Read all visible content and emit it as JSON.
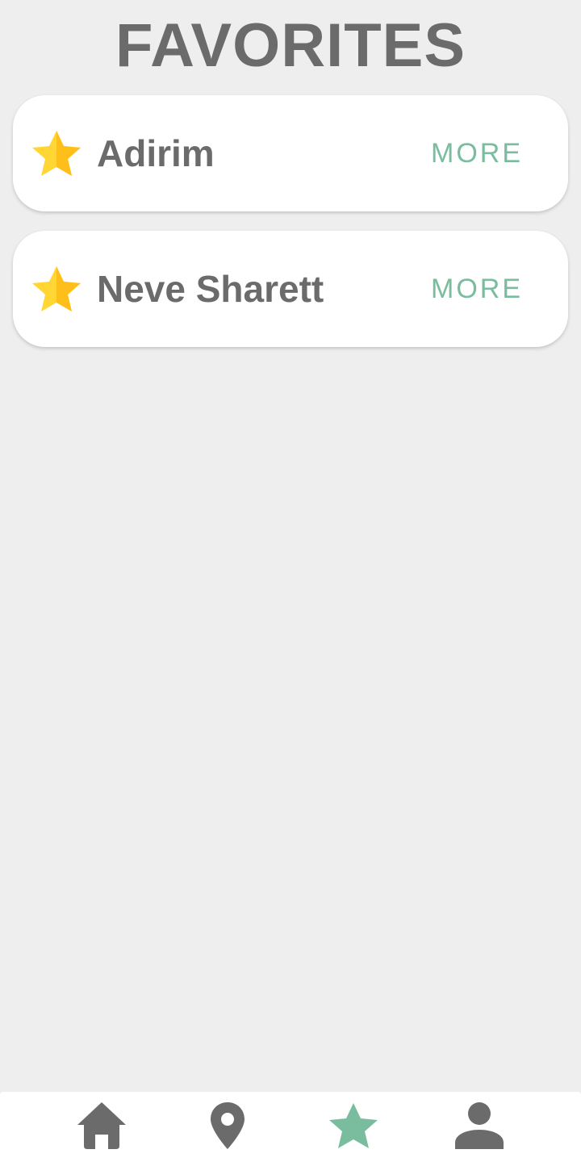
{
  "header": {
    "title": "FAVORITES"
  },
  "favorites": [
    {
      "name": "Adirim",
      "more_label": "MORE",
      "icon": "star-icon"
    },
    {
      "name": "Neve Sharett",
      "more_label": "MORE",
      "icon": "star-icon"
    }
  ],
  "bottom_nav": {
    "items": [
      {
        "icon": "home-icon",
        "active": false
      },
      {
        "icon": "location-pin-icon",
        "active": false
      },
      {
        "icon": "star-icon",
        "active": true
      },
      {
        "icon": "profile-icon",
        "active": false
      }
    ]
  },
  "colors": {
    "background": "#eeeeee",
    "card": "#ffffff",
    "text": "#6b6b6b",
    "accent": "#79bc9e",
    "star_light": "#ffd633",
    "star_dark": "#ffbf1a",
    "nav_inactive": "#6b6b6b"
  }
}
